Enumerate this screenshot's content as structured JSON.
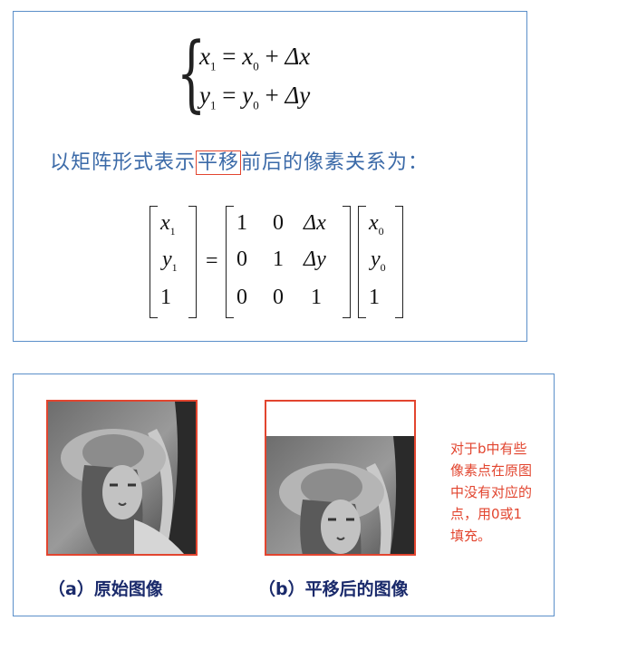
{
  "equations": {
    "line1": {
      "lhs_var": "x",
      "lhs_sub": "1",
      "rhs_var": "x",
      "rhs_sub": "0",
      "delta": "Δx"
    },
    "line2": {
      "lhs_var": "y",
      "lhs_sub": "1",
      "rhs_var": "y",
      "rhs_sub": "0",
      "delta": "Δy"
    }
  },
  "caption": {
    "before": "以矩阵形式表示",
    "highlight": "平移",
    "after": "前后的像素关系为："
  },
  "matrix": {
    "left_vector": [
      {
        "v": "x",
        "s": "1"
      },
      {
        "v": "y",
        "s": "1"
      },
      {
        "v": "1",
        "s": ""
      }
    ],
    "equals": "=",
    "transform": [
      [
        "1",
        "0",
        "Δx"
      ],
      [
        "0",
        "1",
        "Δy"
      ],
      [
        "0",
        "0",
        "1"
      ]
    ],
    "right_vector": [
      {
        "v": "x",
        "s": "0"
      },
      {
        "v": "y",
        "s": "0"
      },
      {
        "v": "1",
        "s": ""
      }
    ]
  },
  "figures": {
    "label_a": "（a）原始图像",
    "label_b": "（b）平移后的图像",
    "note": "对于b中有些像素点在原图中没有对应的点，用0或1填充。"
  },
  "colors": {
    "border": "#5b8fc9",
    "accent_red": "#e2452f",
    "caption_blue": "#3b6aa8",
    "label_navy": "#1a2a6b"
  }
}
